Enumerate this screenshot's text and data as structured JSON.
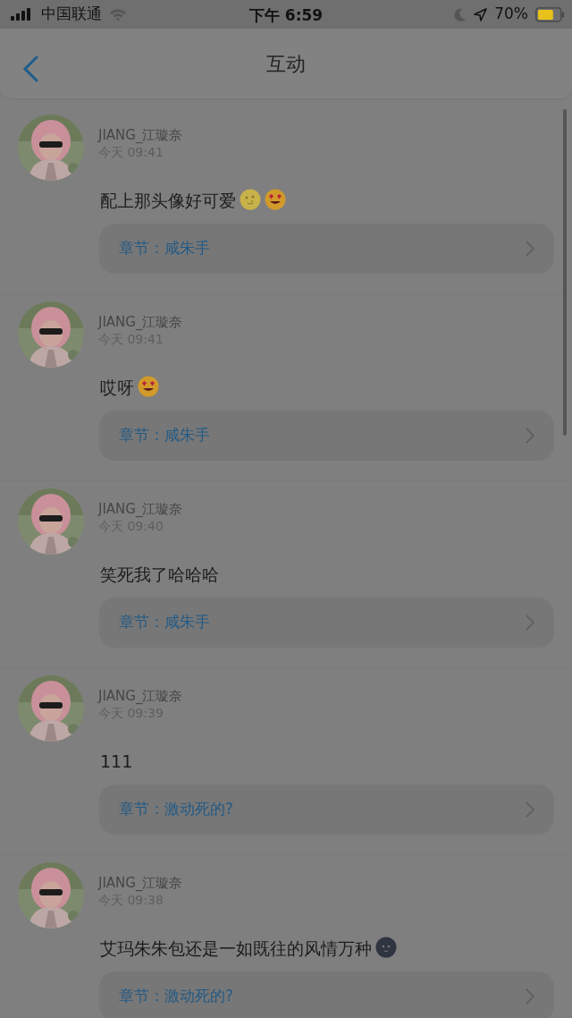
{
  "status_bar": {
    "carrier": "中国联通",
    "time": "下午 6:59",
    "battery": "70%"
  },
  "header": {
    "title": "互动"
  },
  "comments": [
    {
      "user": "JIANG_江璇奈",
      "time": "今天 09:41",
      "text": "配上那头像好可爱",
      "emojis": [
        {
          "kind": "moon-face"
        },
        {
          "kind": "heart-eyes"
        }
      ],
      "chapter": "章节：咸朱手"
    },
    {
      "user": "JIANG_江璇奈",
      "time": "今天 09:41",
      "text": "哎呀",
      "emojis": [
        {
          "kind": "heart-eyes"
        }
      ],
      "chapter": "章节：咸朱手"
    },
    {
      "user": "JIANG_江璇奈",
      "time": "今天 09:40",
      "text": "笑死我了哈哈哈",
      "chapter": "章节：咸朱手"
    },
    {
      "user": "JIANG_江璇奈",
      "time": "今天 09:39",
      "text": "111",
      "chapter": "章节：激动死的?"
    },
    {
      "user": "JIANG_江璇奈",
      "time": "今天 09:38",
      "text": "艾玛朱朱包还是一如既往的风情万种",
      "emojis": [
        {
          "kind": "dark-moon-face"
        }
      ],
      "chapter": "章节：激动死的?"
    }
  ]
}
